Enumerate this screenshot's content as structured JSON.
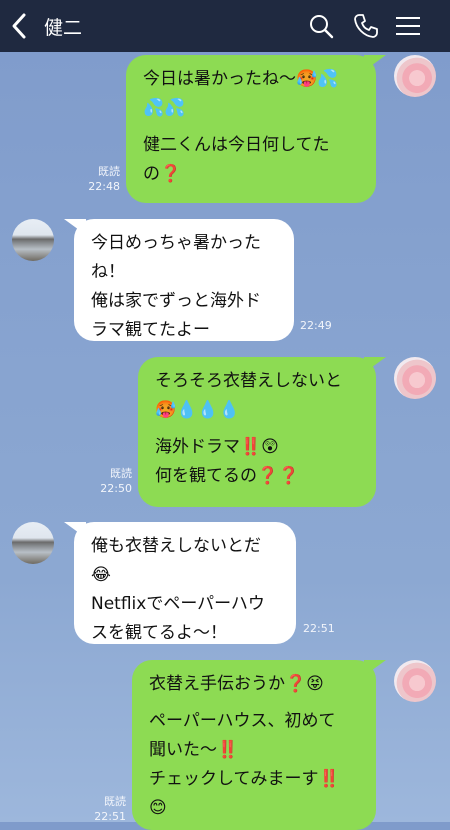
{
  "header": {
    "contact_name": "健二"
  },
  "messages": [
    {
      "side": "right",
      "lines": [
        "今日は暑かったね〜🥵💦",
        "💦💦",
        "",
        "健二くんは今日何してた",
        "の❓"
      ],
      "read_label": "既読",
      "time": "22:48"
    },
    {
      "side": "left",
      "lines": [
        "今日めっちゃ暑かった",
        "ね！",
        "俺は家でずっと海外ド",
        "ラマ観てたよー"
      ],
      "time": "22:49"
    },
    {
      "side": "right",
      "lines": [
        "そろそろ衣替えしないと",
        "🥵💧💧💧",
        "",
        "海外ドラマ‼️😲",
        "何を観てるの❓❓"
      ],
      "read_label": "既読",
      "time": "22:50"
    },
    {
      "side": "left",
      "lines": [
        "俺も衣替えしないとだ",
        "😂",
        "Netflixでペーパーハウ",
        "スを観てるよ〜！"
      ],
      "time": "22:51"
    },
    {
      "side": "right",
      "lines": [
        "衣替え手伝おうか❓😝",
        "",
        "ペーパーハウス、初めて",
        "聞いた〜‼️",
        "チェックしてみまーす‼️",
        "😊"
      ],
      "read_label": "既読",
      "time": "22:51"
    }
  ]
}
